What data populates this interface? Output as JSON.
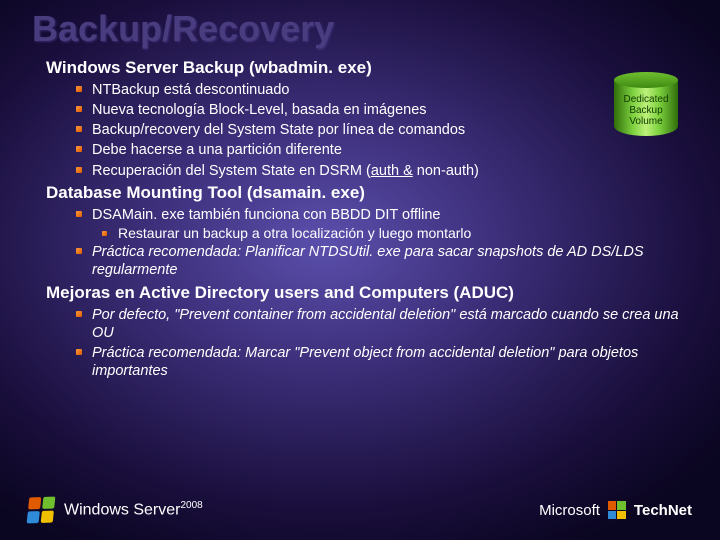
{
  "title": "Backup/Recovery",
  "s1": {
    "h": "Windows Server Backup (wbadmin. exe)",
    "items": [
      "NTBackup está descontinuado",
      "Nueva tecnología Block-Level, basada en imágenes",
      "Backup/recovery del System State por línea de comandos",
      "Debe hacerse a una partición diferente"
    ],
    "item5a": "Recuperación del System State en DSRM (",
    "item5u": "auth &",
    "item5b": " non-auth)"
  },
  "s2": {
    "h": "Database Mounting Tool (dsamain. exe)",
    "i1": "DSAMain. exe también funciona con BBDD DIT offline",
    "i1a": "Restaurar un backup a otra localización y luego montarlo",
    "i2": "Práctica recomendada: Planificar NTDSUtil. exe para sacar snapshots de AD DS/LDS regularmente"
  },
  "s3": {
    "h": "Mejoras en Active Directory users and Computers (ADUC)",
    "i1": "Por defecto, \"Prevent container from accidental deletion\" está marcado cuando se crea una OU",
    "i2": "Práctica recomendada: Marcar \"Prevent object from accidental deletion\" para objetos importantes"
  },
  "db": {
    "l1": "Dedicated",
    "l2": "Backup",
    "l3": "Volume"
  },
  "footer": {
    "ws1": "Windows",
    "ws2": "Server",
    "yr": "2008",
    "ms": "Microsoft",
    "tn": "TechNet"
  }
}
